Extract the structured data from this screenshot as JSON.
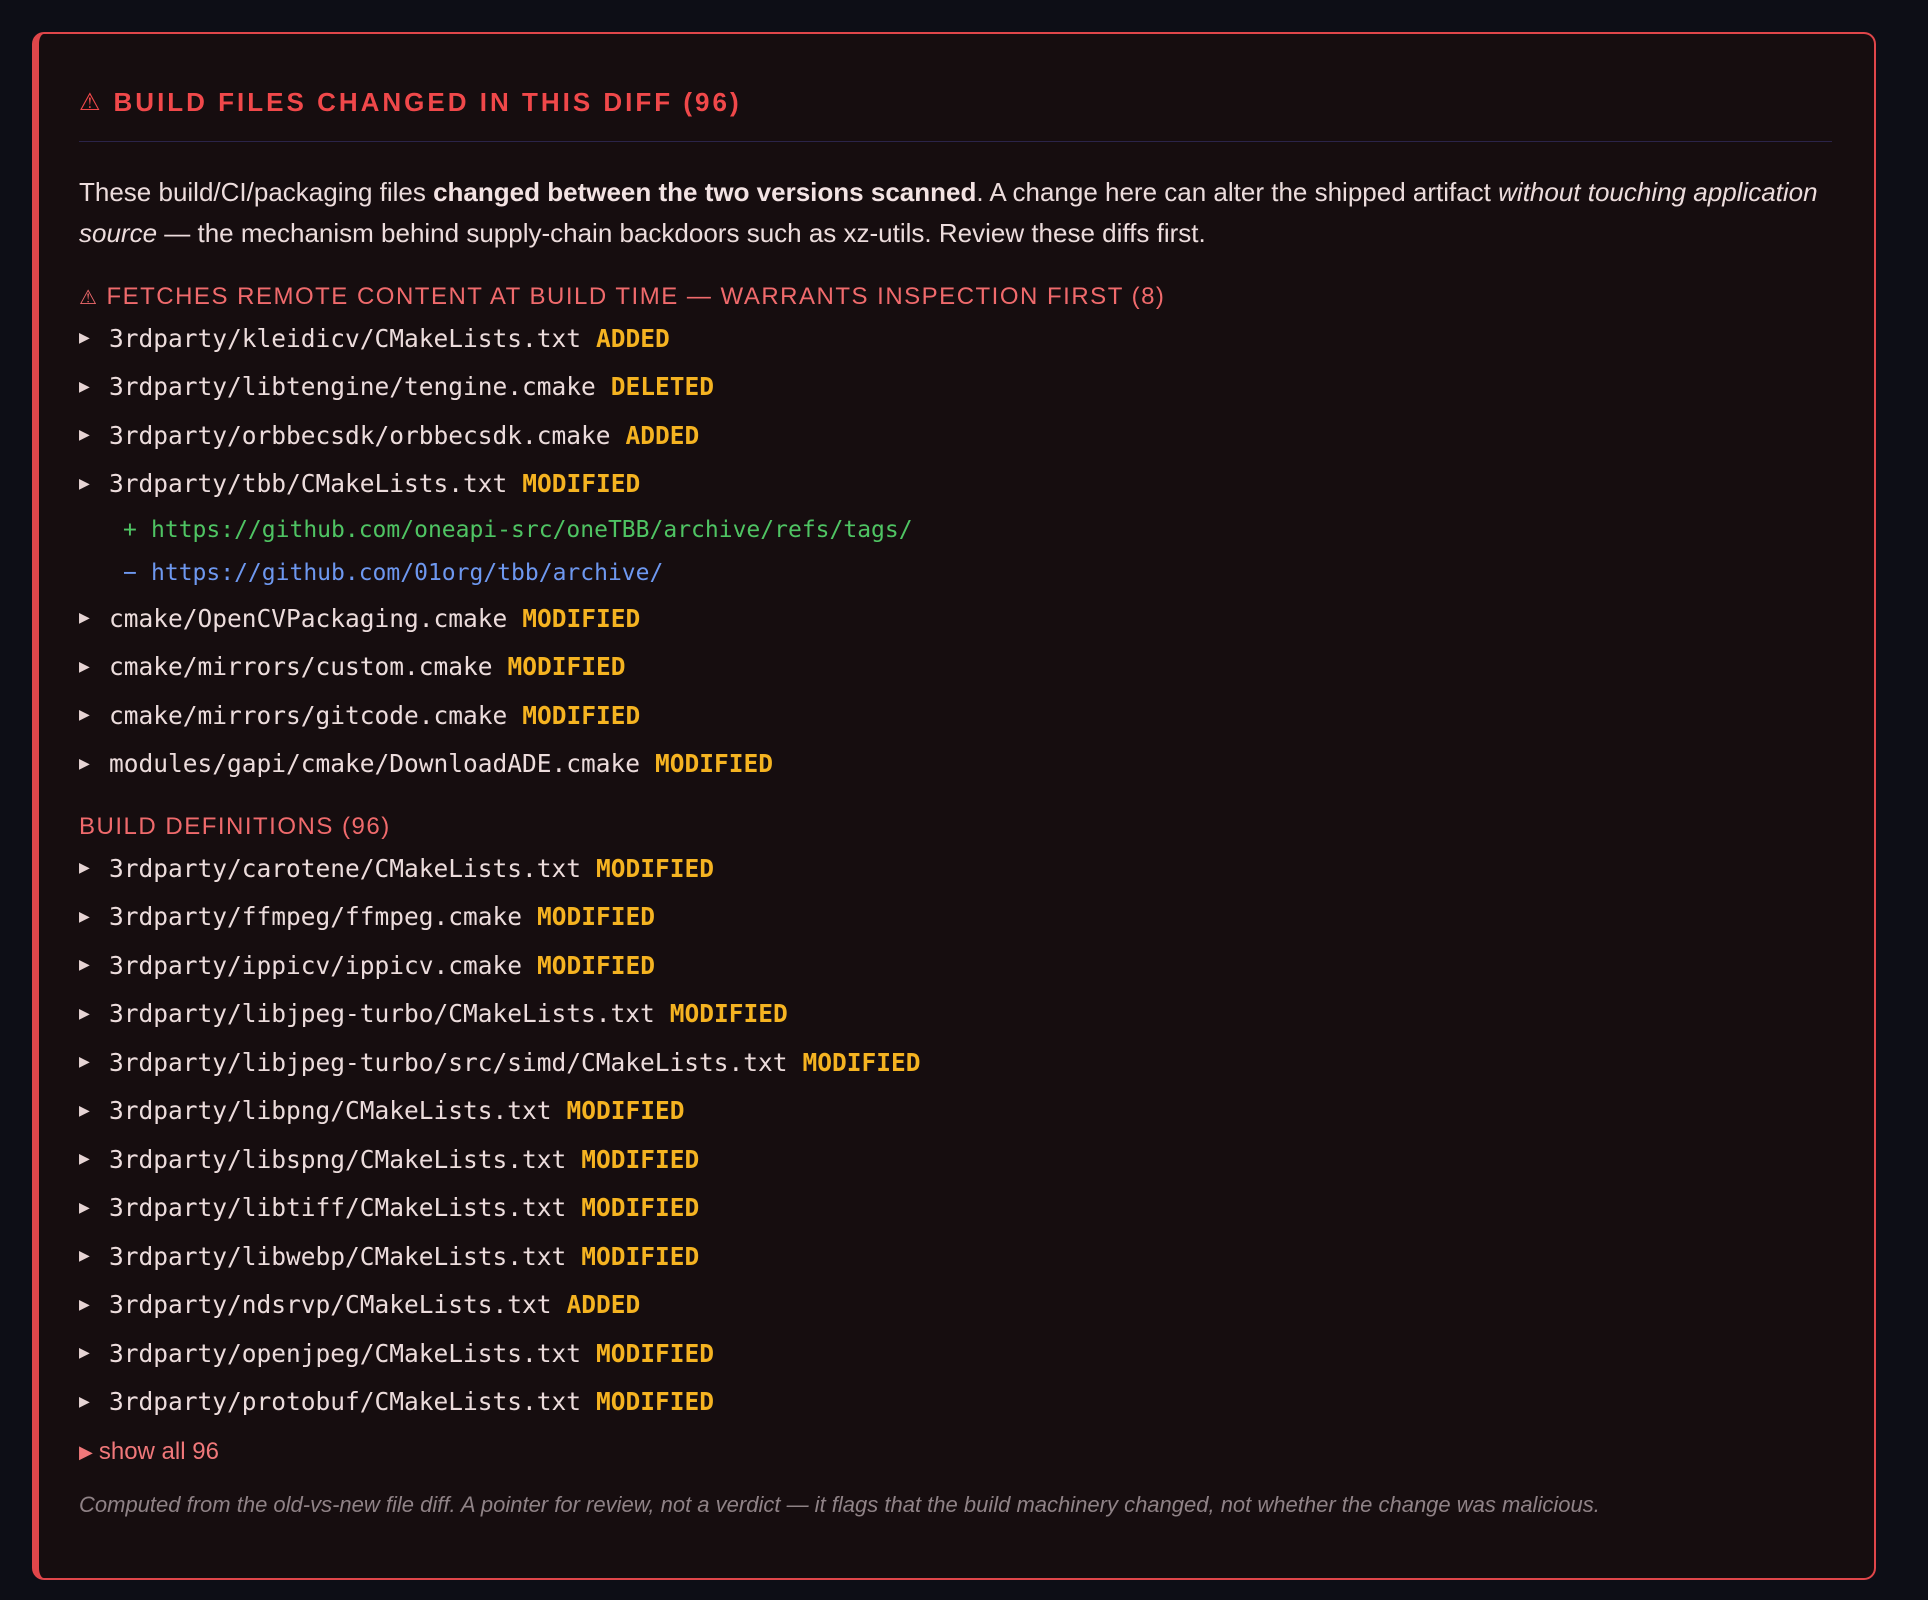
{
  "panel": {
    "title": "BUILD FILES CHANGED IN THIS DIFF (96)",
    "intro": {
      "p1": "These build/CI/packaging files ",
      "b1": "changed between the two versions scanned",
      "p2": ". A change here can alter the shipped artifact ",
      "i1": "without touching application source",
      "p3": " — the mechanism behind supply-chain backdoors such as xz-utils. Review these diffs first."
    },
    "remote_section": {
      "heading": "FETCHES REMOTE CONTENT AT BUILD TIME — WARRANTS INSPECTION FIRST (8)",
      "files": [
        {
          "path": "3rdparty/kleidicv/CMakeLists.txt",
          "status": "ADDED"
        },
        {
          "path": "3rdparty/libtengine/tengine.cmake",
          "status": "DELETED"
        },
        {
          "path": "3rdparty/orbbecsdk/orbbecsdk.cmake",
          "status": "ADDED"
        },
        {
          "path": "3rdparty/tbb/CMakeLists.txt",
          "status": "MODIFIED"
        },
        {
          "path": "cmake/OpenCVPackaging.cmake",
          "status": "MODIFIED"
        },
        {
          "path": "cmake/mirrors/custom.cmake",
          "status": "MODIFIED"
        },
        {
          "path": "cmake/mirrors/gitcode.cmake",
          "status": "MODIFIED"
        },
        {
          "path": "modules/gapi/cmake/DownloadADE.cmake",
          "status": "MODIFIED"
        }
      ],
      "tbb_urls": {
        "added_sign": "+",
        "added": "https://github.com/oneapi-src/oneTBB/archive/refs/tags/",
        "removed_sign": "−",
        "removed": "https://github.com/01org/tbb/archive/"
      }
    },
    "build_section": {
      "heading": "BUILD DEFINITIONS (96)",
      "files": [
        {
          "path": "3rdparty/carotene/CMakeLists.txt",
          "status": "MODIFIED"
        },
        {
          "path": "3rdparty/ffmpeg/ffmpeg.cmake",
          "status": "MODIFIED"
        },
        {
          "path": "3rdparty/ippicv/ippicv.cmake",
          "status": "MODIFIED"
        },
        {
          "path": "3rdparty/libjpeg-turbo/CMakeLists.txt",
          "status": "MODIFIED"
        },
        {
          "path": "3rdparty/libjpeg-turbo/src/simd/CMakeLists.txt",
          "status": "MODIFIED"
        },
        {
          "path": "3rdparty/libpng/CMakeLists.txt",
          "status": "MODIFIED"
        },
        {
          "path": "3rdparty/libspng/CMakeLists.txt",
          "status": "MODIFIED"
        },
        {
          "path": "3rdparty/libtiff/CMakeLists.txt",
          "status": "MODIFIED"
        },
        {
          "path": "3rdparty/libwebp/CMakeLists.txt",
          "status": "MODIFIED"
        },
        {
          "path": "3rdparty/ndsrvp/CMakeLists.txt",
          "status": "ADDED"
        },
        {
          "path": "3rdparty/openjpeg/CMakeLists.txt",
          "status": "MODIFIED"
        },
        {
          "path": "3rdparty/protobuf/CMakeLists.txt",
          "status": "MODIFIED"
        }
      ],
      "show_all_label": "show all 96"
    },
    "footnote": "Computed from the old-vs-new file diff. A pointer for review, not a verdict — it flags that the build machinery changed, not whether the change was malicious.",
    "colors": {
      "accent": "#e0464a",
      "status": "#f5b321",
      "url_added": "#4fc463",
      "url_removed": "#6e98f0"
    },
    "icons": {
      "title_icon": "warning-icon",
      "row_icon": "triangle-right-icon"
    }
  }
}
